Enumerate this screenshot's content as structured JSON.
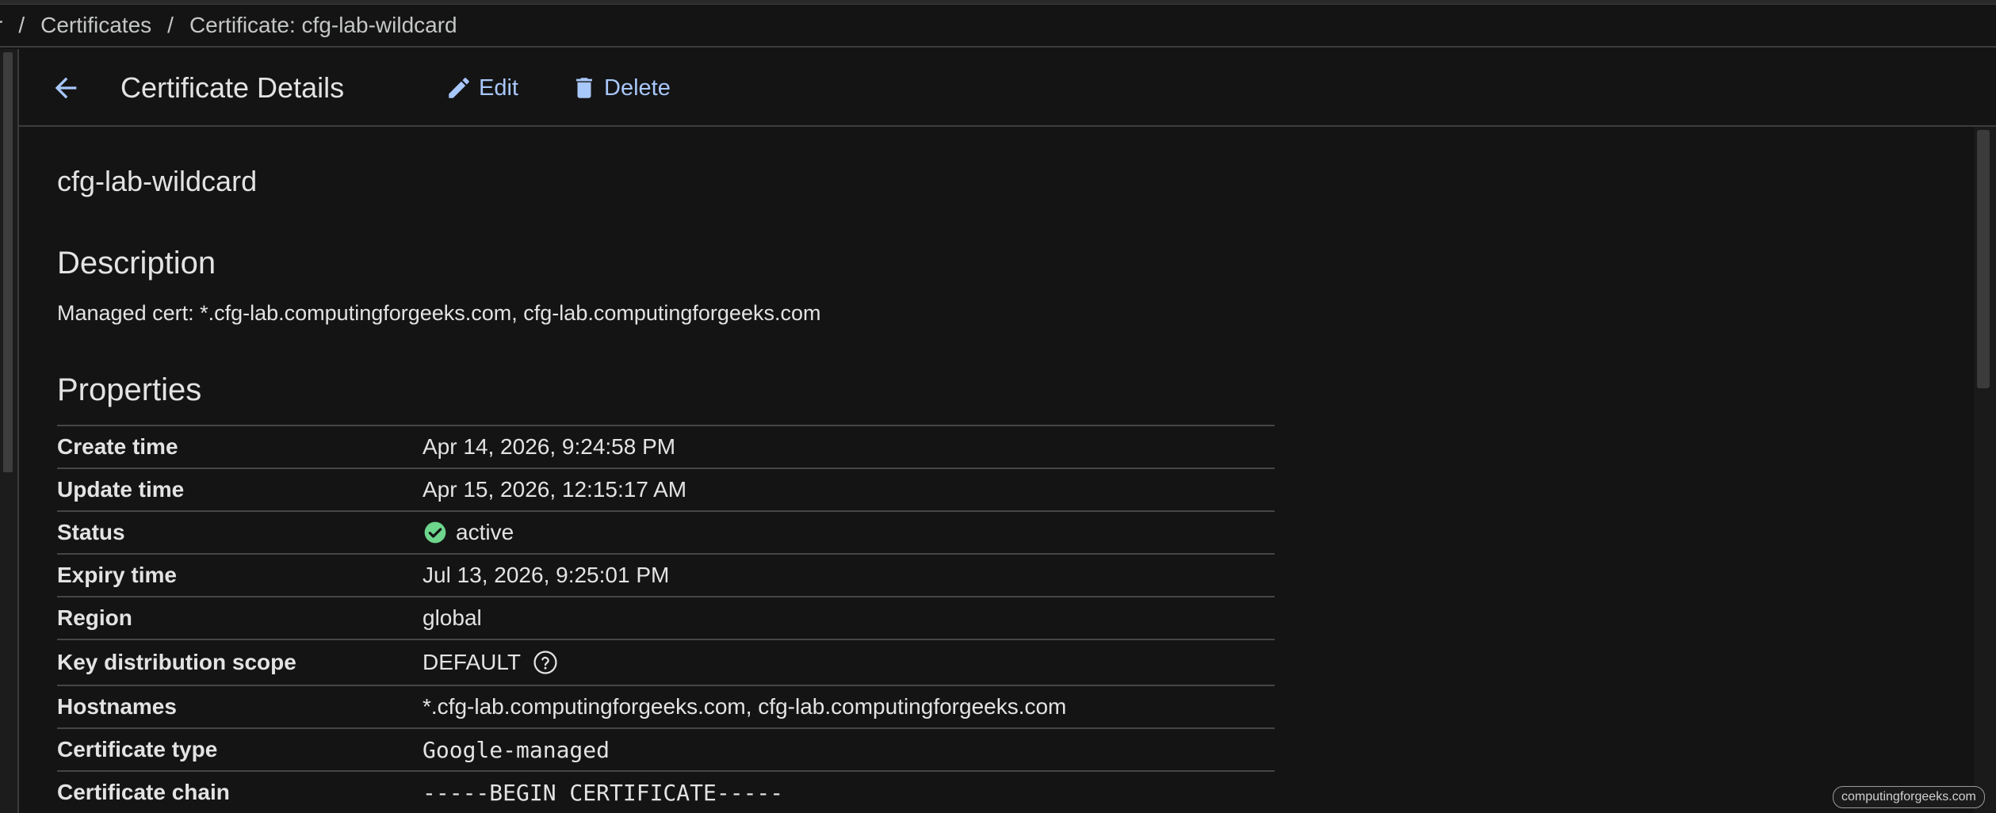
{
  "breadcrumb": {
    "partial": "r",
    "sep1": "/",
    "item1": "Certificates",
    "sep2": "/",
    "item2": "Certificate: cfg-lab-wildcard"
  },
  "header": {
    "title": "Certificate Details",
    "edit_label": "Edit",
    "delete_label": "Delete"
  },
  "certificate": {
    "name": "cfg-lab-wildcard",
    "description_title": "Description",
    "description": "Managed cert: *.cfg-lab.computingforgeeks.com, cfg-lab.computingforgeeks.com",
    "properties_title": "Properties"
  },
  "properties": [
    {
      "key": "Create time",
      "value": "Apr 14, 2026, 9:24:58 PM"
    },
    {
      "key": "Update time",
      "value": "Apr 15, 2026, 12:15:17 AM"
    },
    {
      "key": "Status",
      "value": "active"
    },
    {
      "key": "Expiry time",
      "value": "Jul 13, 2026, 9:25:01 PM"
    },
    {
      "key": "Region",
      "value": "global"
    },
    {
      "key": "Key distribution scope",
      "value": "DEFAULT"
    },
    {
      "key": "Hostnames",
      "value": "*.cfg-lab.computingforgeeks.com, cfg-lab.computingforgeeks.com"
    },
    {
      "key": "Certificate type",
      "value": "Google-managed"
    },
    {
      "key": "Certificate chain",
      "value": "-----BEGIN CERTIFICATE-----"
    }
  ],
  "colors": {
    "accent": "#a8c7fa",
    "status_active": "#6dd58c",
    "background": "#141414"
  },
  "icons": {
    "back": "arrow-back-icon",
    "edit": "pencil-icon",
    "delete": "trash-icon",
    "status": "check-circle-icon",
    "help": "help-circle-icon"
  },
  "watermark": "computingforgeeks.com"
}
